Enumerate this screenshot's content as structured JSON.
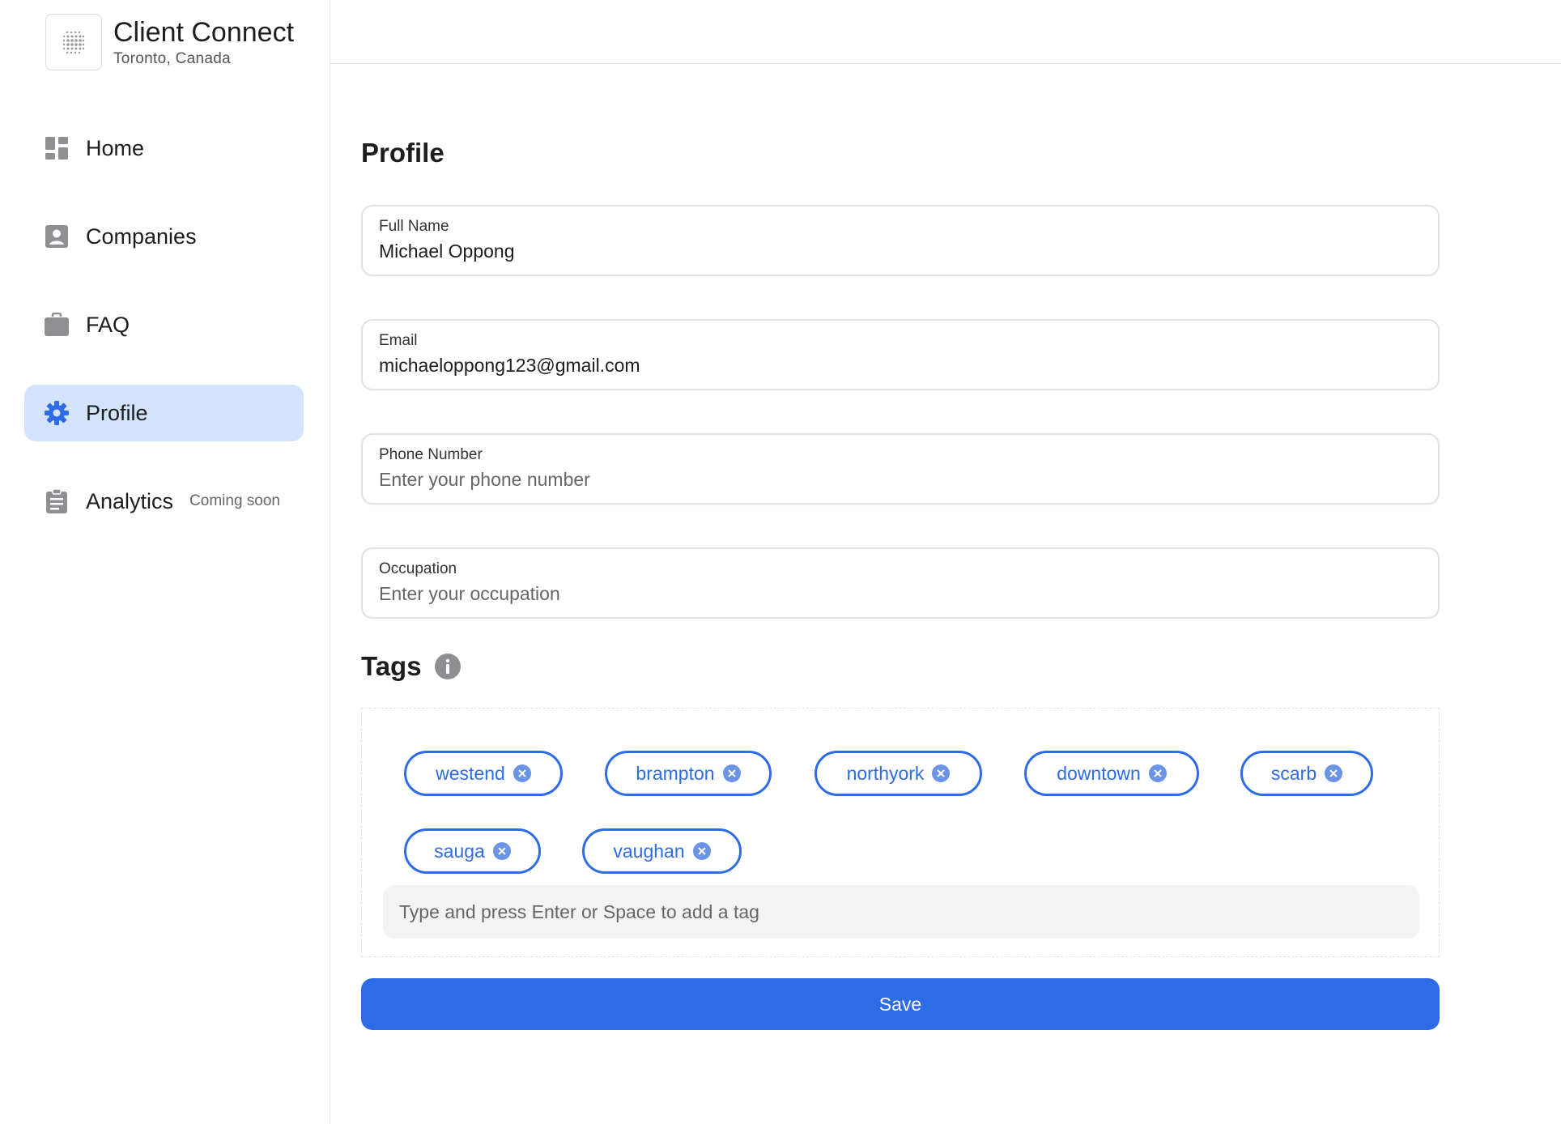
{
  "app": {
    "title": "Client Connect",
    "location": "Toronto, Canada"
  },
  "sidebar": {
    "items": [
      {
        "label": "Home",
        "icon": "dashboard-icon",
        "active": false
      },
      {
        "label": "Companies",
        "icon": "contact-icon",
        "active": false
      },
      {
        "label": "FAQ",
        "icon": "briefcase-icon",
        "active": false
      },
      {
        "label": "Profile",
        "icon": "gear-icon",
        "active": true
      },
      {
        "label": "Analytics",
        "icon": "clipboard-icon",
        "active": false,
        "badge": "Coming soon"
      }
    ]
  },
  "profile": {
    "title": "Profile",
    "full_name": {
      "label": "Full Name",
      "value": "Michael Oppong"
    },
    "email": {
      "label": "Email",
      "value": "michaeloppong123@gmail.com"
    },
    "phone": {
      "label": "Phone Number",
      "value": "",
      "placeholder": "Enter your phone number"
    },
    "occupation": {
      "label": "Occupation",
      "value": "",
      "placeholder": "Enter your occupation"
    }
  },
  "tags": {
    "title": "Tags",
    "items": [
      "westend",
      "brampton",
      "northyork",
      "downtown",
      "scarb",
      "sauga",
      "vaughan"
    ],
    "input_placeholder": "Type and press Enter or Space to add a tag"
  },
  "save_label": "Save",
  "colors": {
    "accent": "#2e6be6",
    "active_nav_bg": "#d3e3fc",
    "icon_gray": "#8e8e93"
  }
}
